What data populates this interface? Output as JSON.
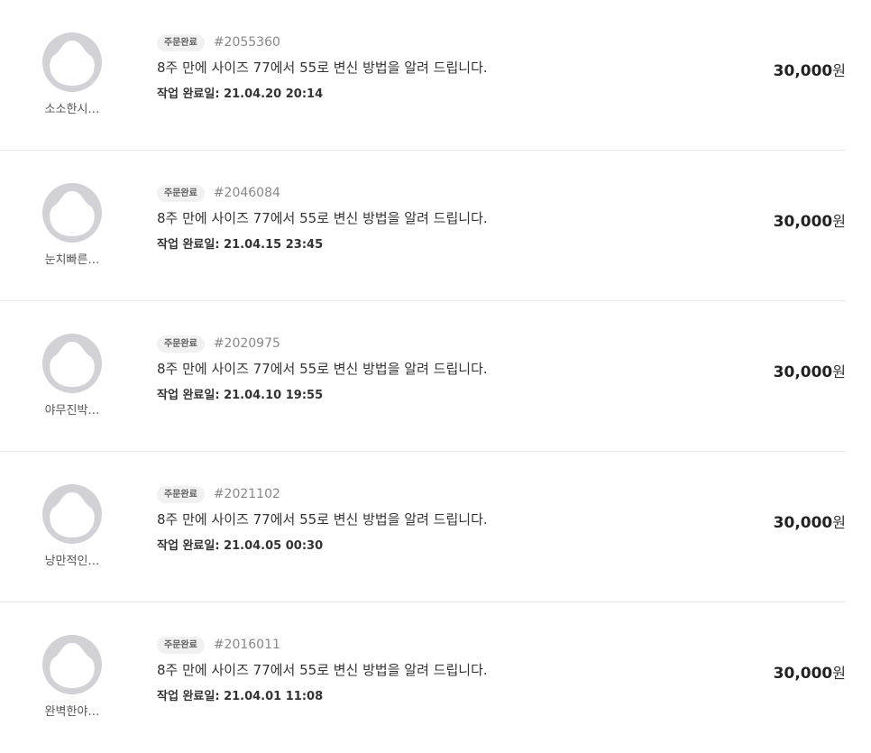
{
  "orders": [
    {
      "buyer_name": "소소한시…",
      "status": "주문완료",
      "order_number": "#2055360",
      "title": "8주 만에 사이즈 77에서 55로 변신 방법을 알려 드립니다.",
      "completed_label": "작업 완료일:",
      "completed_at": "21.04.20 20:14",
      "price": "30,000",
      "currency": "원"
    },
    {
      "buyer_name": "눈치빠른…",
      "status": "주문완료",
      "order_number": "#2046084",
      "title": "8주 만에 사이즈 77에서 55로 변신 방법을 알려 드립니다.",
      "completed_label": "작업 완료일:",
      "completed_at": "21.04.15 23:45",
      "price": "30,000",
      "currency": "원"
    },
    {
      "buyer_name": "야무진박…",
      "status": "주문완료",
      "order_number": "#2020975",
      "title": "8주 만에 사이즈 77에서 55로 변신 방법을 알려 드립니다.",
      "completed_label": "작업 완료일:",
      "completed_at": "21.04.10 19:55",
      "price": "30,000",
      "currency": "원"
    },
    {
      "buyer_name": "낭만적인…",
      "status": "주문완료",
      "order_number": "#2021102",
      "title": "8주 만에 사이즈 77에서 55로 변신 방법을 알려 드립니다.",
      "completed_label": "작업 완료일:",
      "completed_at": "21.04.05 00:30",
      "price": "30,000",
      "currency": "원"
    },
    {
      "buyer_name": "완벽한야…",
      "status": "주문완료",
      "order_number": "#2016011",
      "title": "8주 만에 사이즈 77에서 55로 변신 방법을 알려 드립니다.",
      "completed_label": "작업 완료일:",
      "completed_at": "21.04.01 11:08",
      "price": "30,000",
      "currency": "원"
    }
  ],
  "icons": {
    "avatar": "default-user-avatar-icon"
  },
  "colors": {
    "avatar_ring": "#d2d2d6",
    "badge_bg": "#f1f1f1",
    "divider": "#e9e9e9",
    "text_primary": "#222222",
    "text_muted": "#888888"
  }
}
